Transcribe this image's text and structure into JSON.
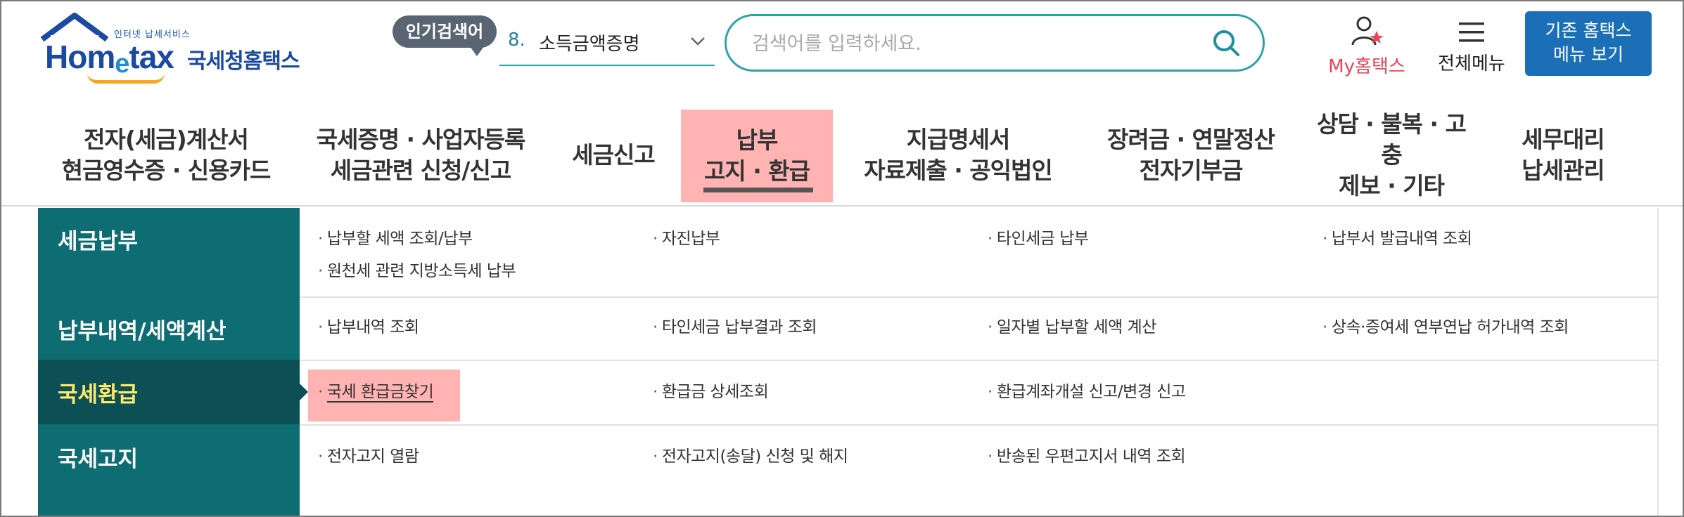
{
  "header": {
    "logo": {
      "sub": "인터넷 납세서비스",
      "main_a": "Hom",
      "main_e": "e",
      "main_b": "tax",
      "kr": "국세청홈택스"
    },
    "popular": {
      "badge": "인기검색어",
      "rank": "8.",
      "keyword": "소득금액증명",
      "chevron_icon": "chevron-down-icon"
    },
    "search": {
      "placeholder": "검색어를 입력하세요.",
      "value": "",
      "icon": "search-icon"
    },
    "my_hometax": {
      "label": "My홈택스",
      "icon": "user-star-icon"
    },
    "all_menu": {
      "label": "전체메뉴",
      "icon": "hamburger-icon"
    },
    "legacy_button": {
      "line1": "기존 홈택스",
      "line2": "메뉴 보기"
    }
  },
  "gnb": [
    {
      "line1": "전자(세금)계산서",
      "line2": "현금영수증 · 신용카드"
    },
    {
      "line1": "국세증명 · 사업자등록",
      "line2": "세금관련 신청/신고"
    },
    {
      "line1": "세금신고",
      "line2": ""
    },
    {
      "line1": "납부",
      "line2": "고지 · 환급",
      "active": true
    },
    {
      "line1": "지급명세서",
      "line2": "자료제출 · 공익법인"
    },
    {
      "line1": "장려금 · 연말정산",
      "line2": "전자기부금"
    },
    {
      "line1": "상담 · 불복 · 고충",
      "line2": "제보 · 기타"
    },
    {
      "line1": "세무대리",
      "line2": "납세관리"
    }
  ],
  "submenu": {
    "categories": [
      {
        "label": "세금납부"
      },
      {
        "label": "납부내역/세액계산"
      },
      {
        "label": "국세환급",
        "active": true
      },
      {
        "label": "국세고지"
      }
    ],
    "links": {
      "r1": [
        "납부할 세액 조회/납부",
        "자진납부",
        "타인세금 납부",
        "납부서 발급내역 조회",
        "원천세 관련 지방소득세 납부"
      ],
      "r2": [
        "납부내역 조회",
        "타인세금 납부결과 조회",
        "일자별 납부할 세액 계산",
        "상속·증여세 연부연납 허가내역 조회"
      ],
      "r3": [
        "국세 환급금찾기",
        "환급금 상세조회",
        "환급계좌개설 신고/변경 신고"
      ],
      "r4": [
        "전자고지 열람",
        "전자고지(송달) 신청 및 해지",
        "반송된 우편고지서 내역 조회"
      ]
    },
    "bullet": "·"
  },
  "colors": {
    "teal": "#0d6d73",
    "teal_active": "#0c4f55",
    "active_text": "#ffea6c",
    "highlight": "#ffb3b3",
    "brand_blue": "#1a6fb6",
    "accent_red": "#e8455a",
    "search_border": "#2aa3a8"
  }
}
